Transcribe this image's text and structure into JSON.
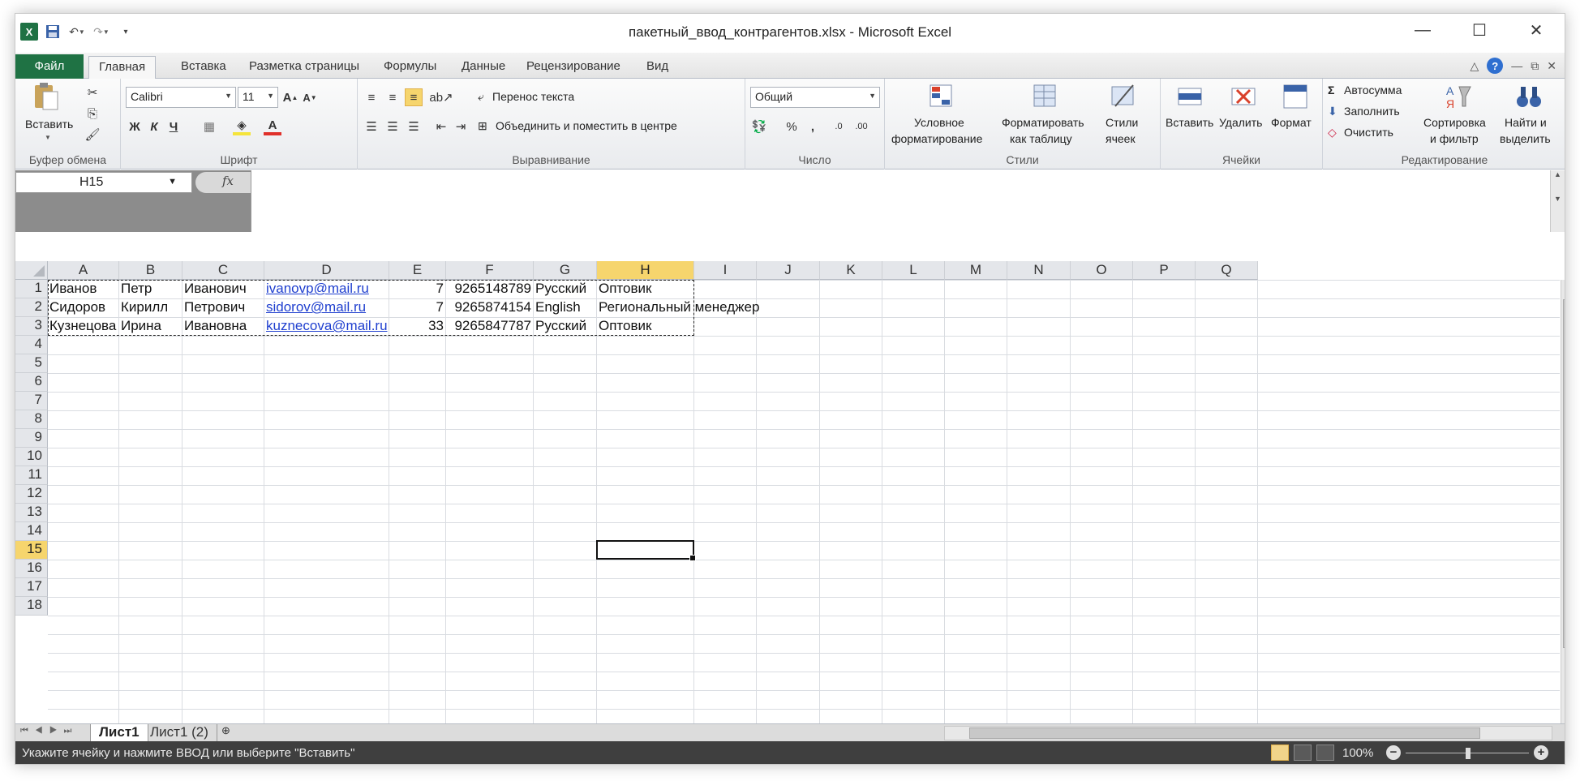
{
  "window": {
    "title": "пакетный_ввод_контрагентов.xlsx - Microsoft Excel"
  },
  "qat": {
    "app_icon": "X"
  },
  "controls": {
    "minimize": "—",
    "maximize": "☐",
    "close": "✕"
  },
  "tabs": [
    {
      "label": "Файл"
    },
    {
      "label": "Главная"
    },
    {
      "label": "Вставка"
    },
    {
      "label": "Разметка страницы"
    },
    {
      "label": "Формулы"
    },
    {
      "label": "Данные"
    },
    {
      "label": "Рецензирование"
    },
    {
      "label": "Вид"
    }
  ],
  "ribbon": {
    "clipboard": {
      "paste": "Вставить",
      "label": "Буфер обмена"
    },
    "font": {
      "name": "Calibri",
      "size": "11",
      "bold": "Ж",
      "italic": "К",
      "underline": "Ч",
      "label": "Шрифт"
    },
    "alignment": {
      "wrap": "Перенос текста",
      "merge": "Объединить и поместить в центре",
      "label": "Выравнивание"
    },
    "number": {
      "format": "Общий",
      "percent": "%",
      "comma": ",",
      "label": "Число"
    },
    "styles": {
      "conditional": "Условное",
      "conditional2": "форматирование",
      "as_table": "Форматировать",
      "as_table2": "как таблицу",
      "cell_styles": "Стили",
      "cell_styles2": "ячеек",
      "label": "Стили"
    },
    "cells": {
      "insert": "Вставить",
      "delete": "Удалить",
      "format": "Формат",
      "label": "Ячейки"
    },
    "editing": {
      "autosum": "Автосумма",
      "fill": "Заполнить",
      "clear": "Очистить",
      "sort": "Сортировка",
      "sort2": "и фильтр",
      "find": "Найти и",
      "find2": "выделить",
      "label": "Редактирование"
    }
  },
  "formula_bar": {
    "name_box": "H15",
    "fx": "fx",
    "value": ""
  },
  "columns": [
    "A",
    "B",
    "C",
    "D",
    "E",
    "F",
    "G",
    "H",
    "I",
    "J",
    "K",
    "L",
    "M",
    "N",
    "O",
    "P",
    "Q"
  ],
  "rows": [
    "1",
    "2",
    "3",
    "4",
    "5",
    "6",
    "7",
    "8",
    "9",
    "10",
    "11",
    "12",
    "13",
    "14",
    "15",
    "16",
    "17",
    "18"
  ],
  "data": [
    {
      "A": "Иванов",
      "B": "Петр",
      "C": "Иванович",
      "D": "ivanovp@mail.ru",
      "E": "7",
      "F": "9265148789",
      "G": "Русский",
      "H": "Оптовик"
    },
    {
      "A": "Сидоров",
      "B": "Кирилл",
      "C": "Петрович",
      "D": "sidorov@mail.ru",
      "E": "7",
      "F": "9265874154",
      "G": "English",
      "H": "Региональный менеджер"
    },
    {
      "A": "Кузнецова",
      "B": "Ирина",
      "C": "Ивановна",
      "D": "kuznecova@mail.ru",
      "E": "33",
      "F": "9265847787",
      "G": "Русский",
      "H": "Оптовик"
    }
  ],
  "active_cell": "H15",
  "sheets": [
    {
      "label": "Лист1"
    },
    {
      "label": "Лист1 (2)"
    }
  ],
  "status": {
    "message": "Укажите ячейку и нажмите ВВОД или выберите \"Вставить\"",
    "zoom": "100%"
  }
}
